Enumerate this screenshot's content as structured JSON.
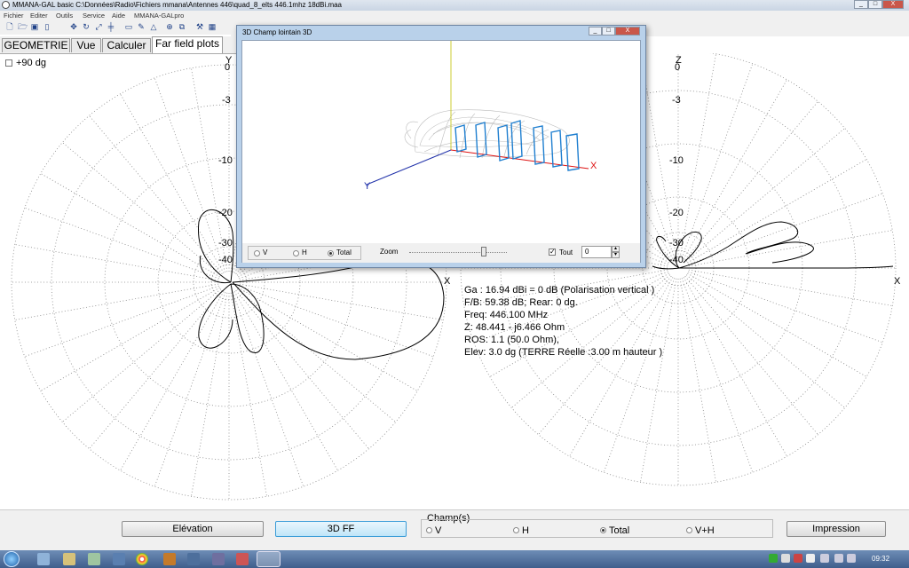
{
  "window": {
    "title": "MMANA-GAL basic C:\\Données\\Radio\\Fichiers mmana\\Antennes 446\\quad_8_elts 446.1mhz 18dBi.maa",
    "controls": [
      "_",
      "□",
      "X"
    ]
  },
  "menu": [
    "Fichier",
    "Editer",
    "Outils",
    "Service",
    "Aide",
    "MMANA-GALpro"
  ],
  "tabs": [
    "GEOMETRIE",
    "Vue",
    "Calculer",
    "Far field plots"
  ],
  "active_tab": "Far field plots",
  "checkbox_90": {
    "label": "+90 dg",
    "checked": false
  },
  "polar_left": {
    "axis_top": "Y",
    "axis_right": "X",
    "rings": [
      "0",
      "-3",
      "-10",
      "-20",
      "-30",
      "-40"
    ]
  },
  "polar_right": {
    "axis_top": "Z",
    "axis_right": "X",
    "rings": [
      "0",
      "-3",
      "-10",
      "-20",
      "-30",
      "-40"
    ]
  },
  "info": {
    "line1": "Ga : 16.94 dBi = 0 dB  (Polarisation vertical )",
    "line2": "F/B: 59.38 dB; Rear: 0 dg.",
    "line3": "Freq: 446.100 MHz",
    "line4": "Z: 48.441 - j6.466 Ohm",
    "line5": "ROS: 1.1 (50.0 Ohm),",
    "line6": "Elev: 3.0 dg (TERRE Réelle   :3.00 m hauteur )"
  },
  "buttons": {
    "elevation": "Elévation",
    "ff3d": "3D FF",
    "impression": "Impression"
  },
  "champs": {
    "legend": "Champ(s)",
    "options": [
      "V",
      "H",
      "Total",
      "V+H"
    ],
    "selected": "Total"
  },
  "win3d": {
    "title": "3D  Champ lointain 3D",
    "axis_y": "Y",
    "axis_x": "X",
    "radios": [
      "V",
      "H",
      "Total"
    ],
    "radio_selected": "Total",
    "zoom_label": "Zoom",
    "zoom_level": 0.78,
    "tout_label": "Tout",
    "tout_checked": true,
    "spin_value": "0"
  },
  "taskbar": {
    "clock": "09:32"
  },
  "colors": {
    "accent": "#3c9dd8",
    "pattern": "#000000",
    "grid": "#888888",
    "elements3d": "#1f7fd0",
    "axisx": "#d11",
    "axisy": "#2233aa",
    "axisz": "#cccc33"
  }
}
